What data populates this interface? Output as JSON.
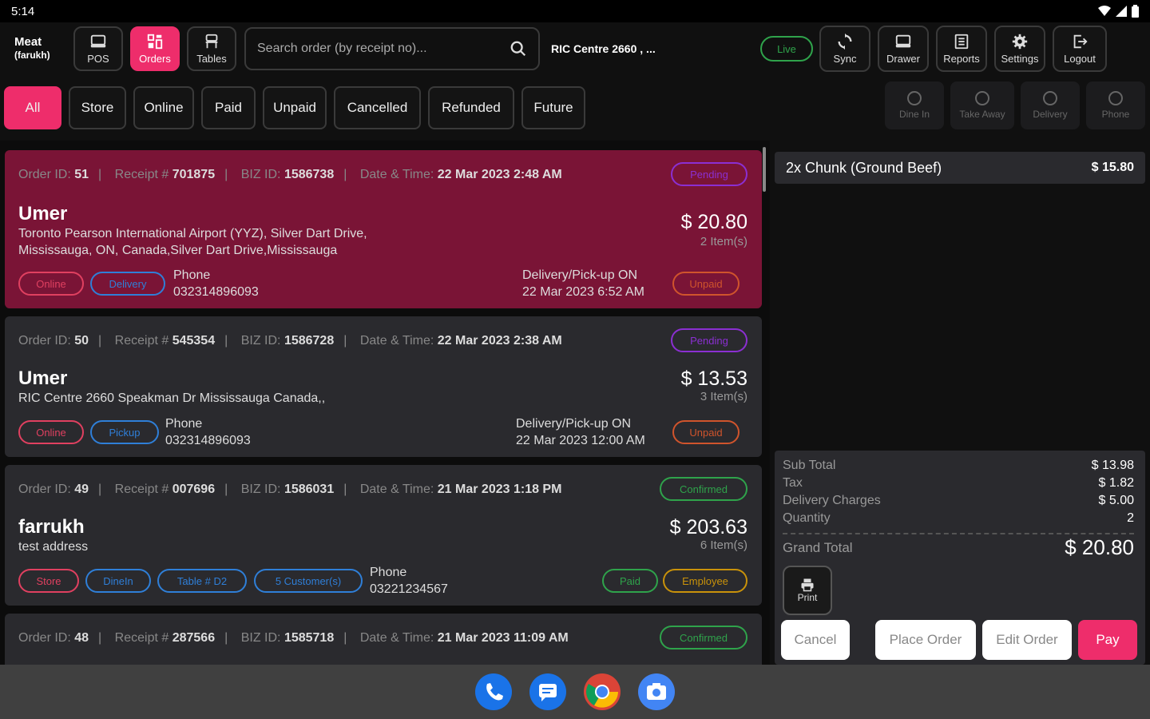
{
  "statusbar": {
    "time": "5:14"
  },
  "header": {
    "brand_name": "Meat",
    "brand_user": "(farukh)",
    "nav": [
      {
        "label": "POS",
        "icon": "pos-icon"
      },
      {
        "label": "Orders",
        "icon": "orders-icon"
      },
      {
        "label": "Tables",
        "icon": "tables-icon"
      }
    ],
    "search_placeholder": "Search order (by receipt no)...",
    "store_name": "RIC Centre 2660 , ...",
    "live_label": "Live",
    "actions": [
      {
        "label": "Sync",
        "icon": "sync-icon"
      },
      {
        "label": "Drawer",
        "icon": "drawer-icon"
      },
      {
        "label": "Reports",
        "icon": "reports-icon"
      },
      {
        "label": "Settings",
        "icon": "gear-icon"
      },
      {
        "label": "Logout",
        "icon": "logout-icon"
      }
    ]
  },
  "filters": [
    "All",
    "Store",
    "Online",
    "Paid",
    "Unpaid",
    "Cancelled",
    "Refunded",
    "Future"
  ],
  "order_types": [
    "Dine In",
    "Take Away",
    "Delivery",
    "Phone"
  ],
  "labels": {
    "order_id": "Order ID:",
    "receipt": "Receipt #",
    "biz_id": "BIZ ID:",
    "date_time": "Date & Time:",
    "phone": "Phone",
    "delivery_on": "Delivery/Pick-up ON"
  },
  "orders": [
    {
      "order_id": "51",
      "receipt": "701875",
      "biz_id": "1586738",
      "datetime": "22 Mar 2023 2:48 AM",
      "status": "Pending",
      "name": "Umer",
      "address_line1": "Toronto Pearson International Airport (YYZ), Silver Dart Drive,",
      "address_line2": "Mississauga, ON, Canada,Silver Dart Drive,Mississauga",
      "amount": "$ 20.80",
      "items": "2 Item(s)",
      "tag1": "Online",
      "tag2": "Delivery",
      "phone": "032314896093",
      "delivery_time": "22 Mar 2023 6:52 AM",
      "payment": "Unpaid"
    },
    {
      "order_id": "50",
      "receipt": "545354",
      "biz_id": "1586728",
      "datetime": "22 Mar 2023 2:38 AM",
      "status": "Pending",
      "name": "Umer",
      "address_line1": "RIC Centre 2660 Speakman Dr Mississauga Canada,,",
      "amount": "$ 13.53",
      "items": "3 Item(s)",
      "tag1": "Online",
      "tag2": "Pickup",
      "phone": "032314896093",
      "delivery_time": "22 Mar 2023 12:00 AM",
      "payment": "Unpaid"
    },
    {
      "order_id": "49",
      "receipt": "007696",
      "biz_id": "1586031",
      "datetime": "21 Mar 2023 1:18 PM",
      "status": "Confirmed",
      "name": "farrukh",
      "address_line1": "test address",
      "amount": "$ 203.63",
      "items": "6 Item(s)",
      "tag1": "Store",
      "tag2": "DineIn",
      "tag3": "Table # D2",
      "tag4": "5 Customer(s)",
      "phone": "03221234567",
      "payment": "Paid",
      "payer": "Employee"
    },
    {
      "order_id": "48",
      "receipt": "287566",
      "biz_id": "1585718",
      "datetime": "21 Mar 2023 11:09 AM",
      "status": "Confirmed"
    }
  ],
  "cart": {
    "lines": [
      {
        "qty_name": "2x  Chunk (Ground Beef)",
        "price": "$ 15.80"
      }
    ],
    "sub_total_label": "Sub Total",
    "sub_total": "$ 13.98",
    "tax_label": "Tax",
    "tax": "$ 1.82",
    "delivery_label": "Delivery Charges",
    "delivery": "$ 5.00",
    "quantity_label": "Quantity",
    "quantity": "2",
    "grand_total_label": "Grand Total",
    "grand_total": "$ 20.80",
    "print_label": "Print",
    "buttons": {
      "cancel": "Cancel",
      "place": "Place Order",
      "edit": "Edit Order",
      "pay": "Pay"
    }
  },
  "colors": {
    "accent": "#ee2d6b",
    "selected_card": "#7a1436",
    "card": "#2a2a2e"
  },
  "dock": [
    "phone-app-icon",
    "messages-app-icon",
    "chrome-app-icon",
    "camera-app-icon"
  ]
}
